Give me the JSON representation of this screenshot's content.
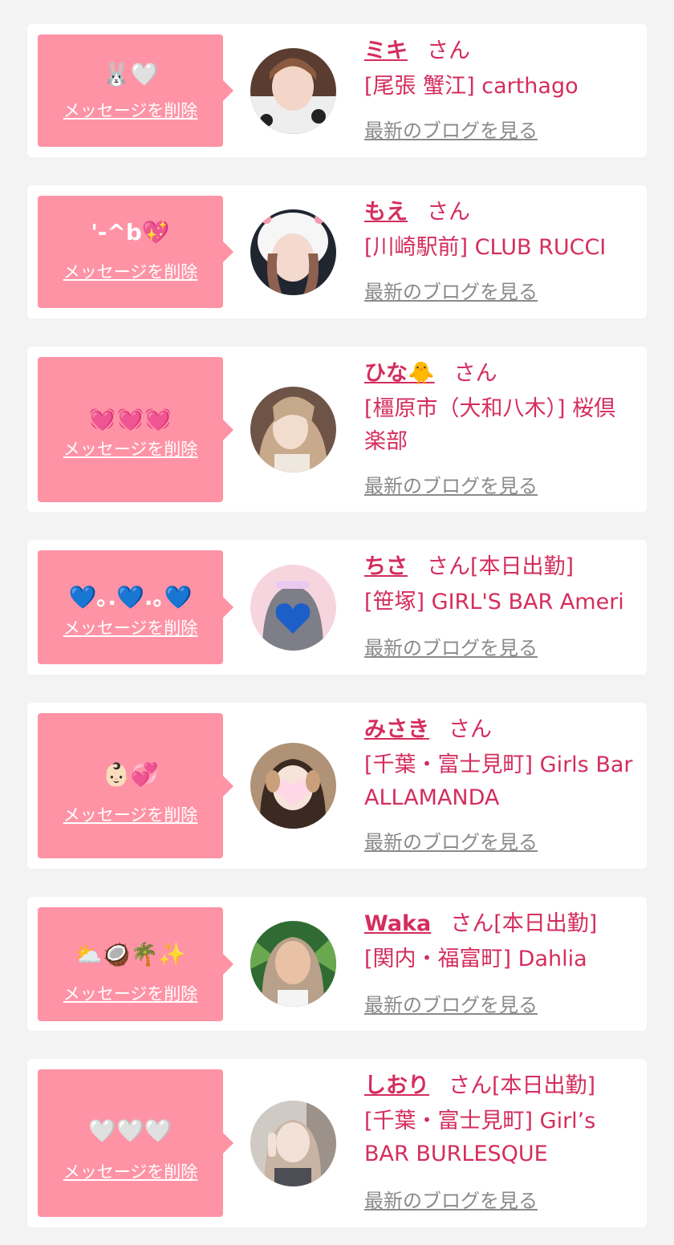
{
  "common": {
    "delete_label": "メッセージを削除",
    "blog_label": "最新のブログを見る",
    "san": "さん"
  },
  "colors": {
    "background": "#f3f3f3",
    "bubble": "#ff93a6",
    "accent_text": "#d42d5e",
    "link_gray": "#8a8a8a"
  },
  "cards": [
    {
      "message": "🐰🤍",
      "name": "ミキ",
      "suffix": "さん",
      "shop": "[尾張 蟹江] carthago"
    },
    {
      "message": "'-^b💖",
      "name": "もえ",
      "suffix": "さん",
      "shop": "[川崎駅前] CLUB RUCCI"
    },
    {
      "message": "💓💓💓",
      "name": "ひな🐥",
      "suffix": "さん",
      "shop": "[橿原市（大和八木）] 桜倶楽部"
    },
    {
      "message": "💙｡.💙.｡💙",
      "name": "ちさ",
      "suffix": "さん[本日出勤]",
      "shop": "[笹塚] GIRL'S BAR Ameri"
    },
    {
      "message": "👶🏻💞",
      "name": "みさき",
      "suffix": "さん",
      "shop": "[千葉・富士見町] Girls Bar ALLAMANDA"
    },
    {
      "message": "⛅🥥🌴✨",
      "name": "Waka",
      "suffix": "さん[本日出勤]",
      "shop": "[関内・福富町] Dahlia"
    },
    {
      "message": "🤍🤍🤍",
      "name": "しおり",
      "suffix": "さん[本日出勤]",
      "shop": "[千葉・富士見町] Girl’s BAR BURLESQUE"
    }
  ]
}
